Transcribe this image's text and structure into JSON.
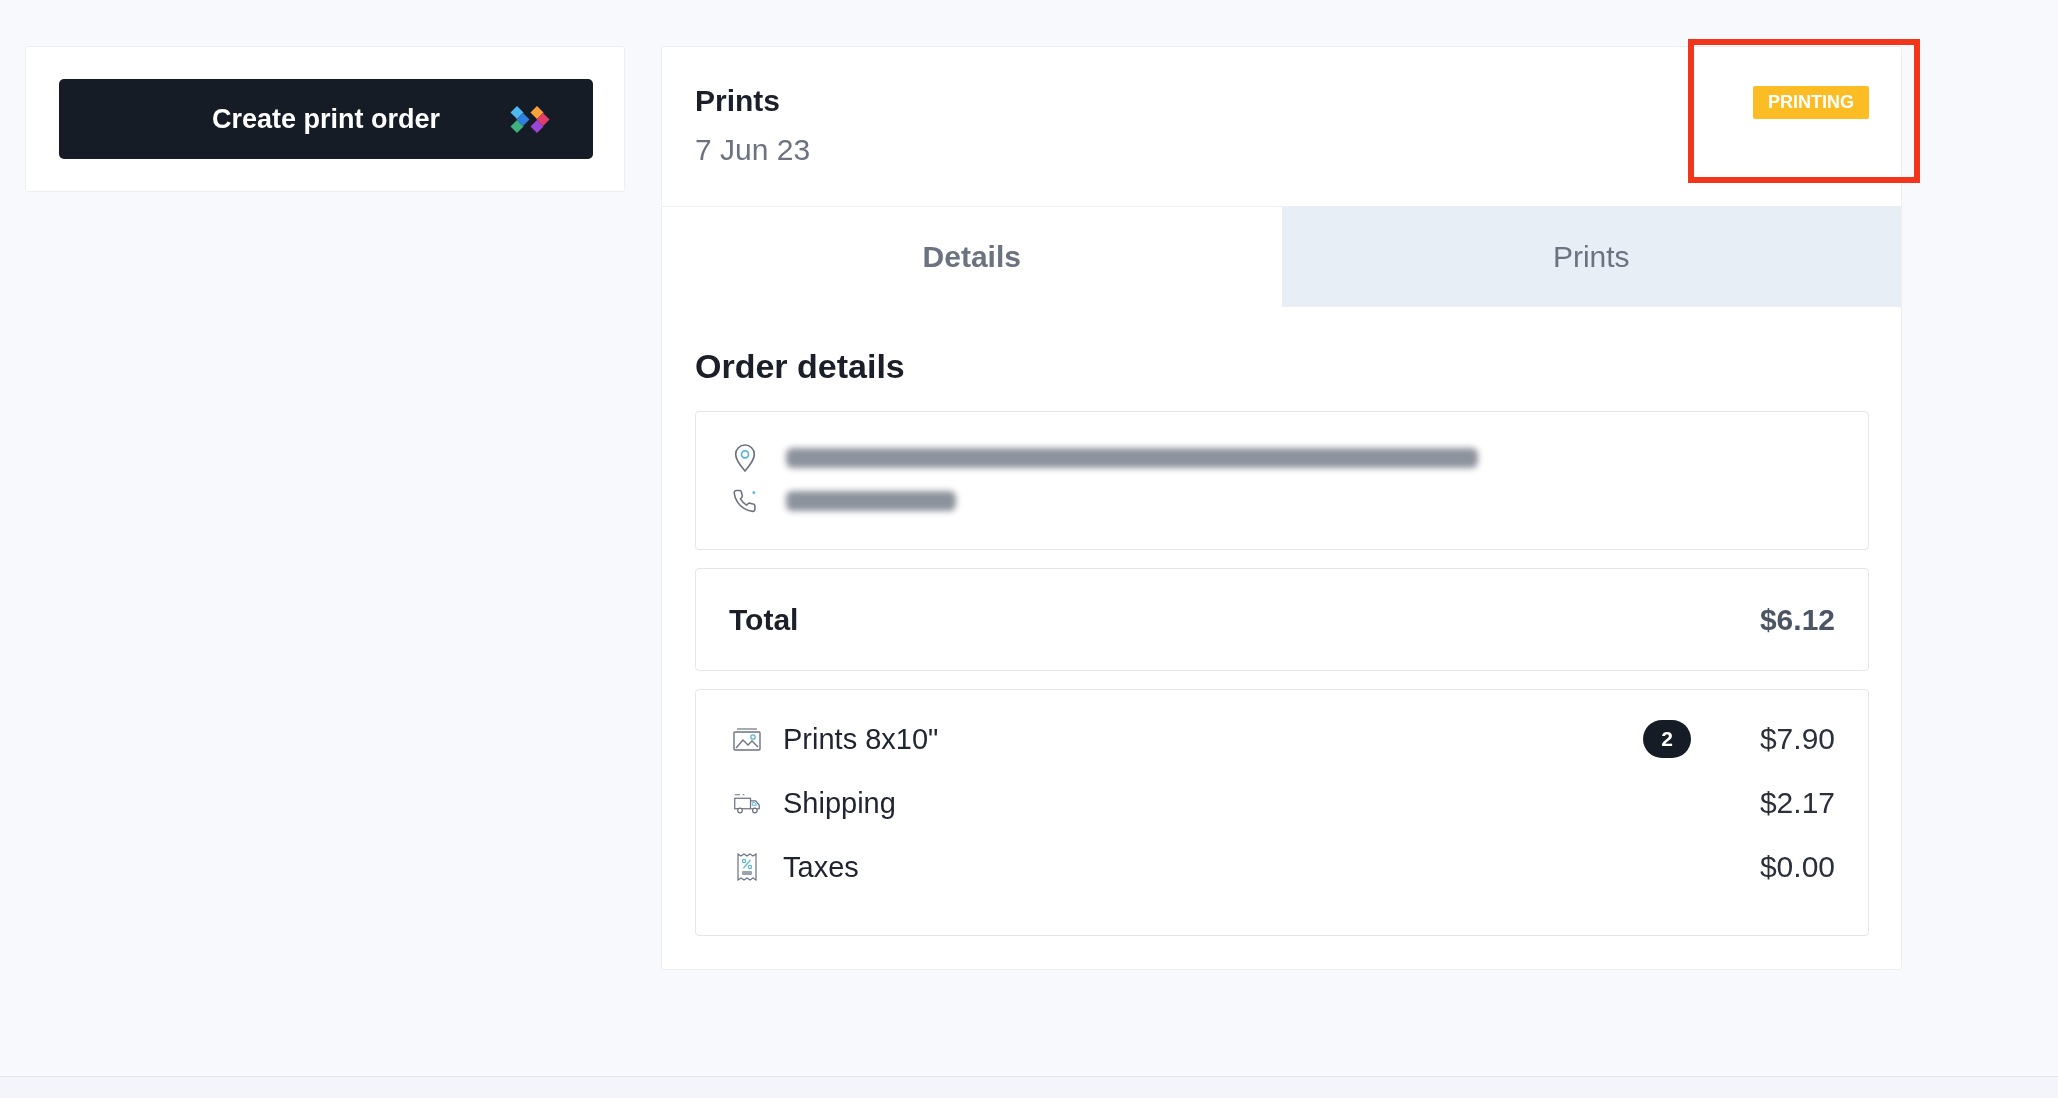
{
  "sidebar": {
    "create_button": {
      "label": "Create print order"
    }
  },
  "order": {
    "title": "Prints",
    "date": "7 Jun 23",
    "status": {
      "label": "PRINTING"
    }
  },
  "tabs": [
    {
      "label": "Details",
      "selected": true
    },
    {
      "label": "Prints",
      "selected": false
    }
  ],
  "details": {
    "heading": "Order details",
    "contact": [
      {
        "kind": "address"
      },
      {
        "kind": "phone"
      }
    ],
    "total": {
      "label": "Total",
      "value": "$6.12"
    },
    "line_items": [
      {
        "kind": "prints",
        "label": "Prints 8x10\"",
        "count": "2",
        "price": "$7.90"
      },
      {
        "kind": "shipping",
        "label": "Shipping",
        "price": "$2.17"
      },
      {
        "kind": "taxes",
        "label": "Taxes",
        "price": "$0.00"
      }
    ]
  }
}
